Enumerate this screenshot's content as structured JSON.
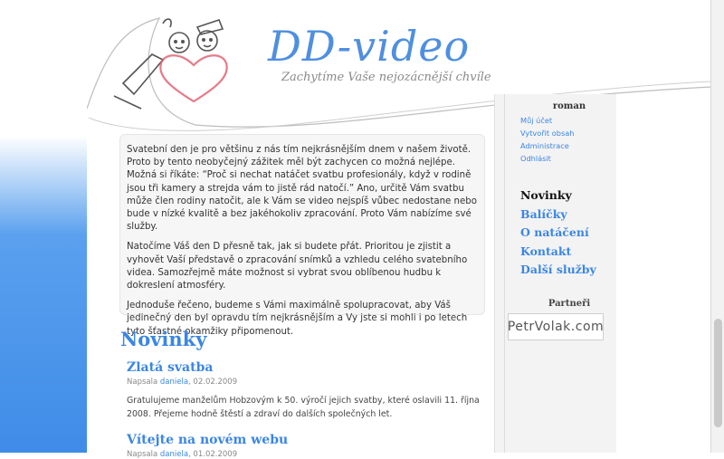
{
  "header": {
    "title": "DD-video",
    "tagline": "Zachytíme Vaše nejozácnější chvíle"
  },
  "intro": [
    "Svateb­ní den je pro většinu z nás tím nejkrásnějším dnem v našem životě. Proto by tento neobyčejný zážitek měl být zachycen co možná nejlépe. Možná si říkáte: “Proč si nechat natáčet svatbu profesionály, když v rodině jsou tři kamery a strejda vám to jistě rád natočí.” Ano, určitě Vám svatbu může člen rodiny natočit, ale k Vám se video nejspíš vůbec nedostane nebo bude v nízké kvalitě a bez jakéhokoliv zpracování. Proto Vám nabízíme své služby.",
    "Natočíme Váš den D přesně tak, jak si budete přát. Prioritou je zjistit a vyhovět Vaší představě o zpracování snímků a vzhledu celého svatebního videa. Samozřejmě máte možnost si vybrat svou oblíbenou hudbu k dokreslení atmosféry.",
    "Jednoduše řečeno, budeme s Vámi maximálně spolupracovat, aby Váš jedinečný den byl opravdu tím nejkrásnějším a Vy jste si mohli i po letech tyto šťastné okamžiky připomenout."
  ],
  "news": {
    "title": "Novinky",
    "posts": [
      {
        "title": "Zlatá svatba",
        "meta_prefix": "Napsala",
        "author": "daniela",
        "date": ", 02.02.2009",
        "body": "Gratulujeme manželům Hobzovým k 50. výročí jejich svatby, které oslavili 11. října 2008. Přejeme hodně štěstí a zdraví do dalších společných let."
      },
      {
        "title": "Vítejte na novém webu",
        "meta_prefix": "Napsala",
        "author": "daniela",
        "date": ", 01.02.2009",
        "body": ""
      }
    ]
  },
  "sidebar": {
    "user_name": "roman",
    "user_links": [
      "Můj účet",
      "Vytvořit obsah",
      "Administrace",
      "Odhlásit"
    ],
    "nav": [
      "Novinky",
      "Balíčky",
      "O natáčení",
      "Kontakt",
      "Další služby"
    ],
    "active_nav": "Novinky",
    "partners_title": "Partneři",
    "partner_logo_text": "PetrVolak.com"
  },
  "colors": {
    "accent": "#3b86e3",
    "background_gradient_end": "#3f8ce8",
    "heart": "#e05a6a"
  }
}
